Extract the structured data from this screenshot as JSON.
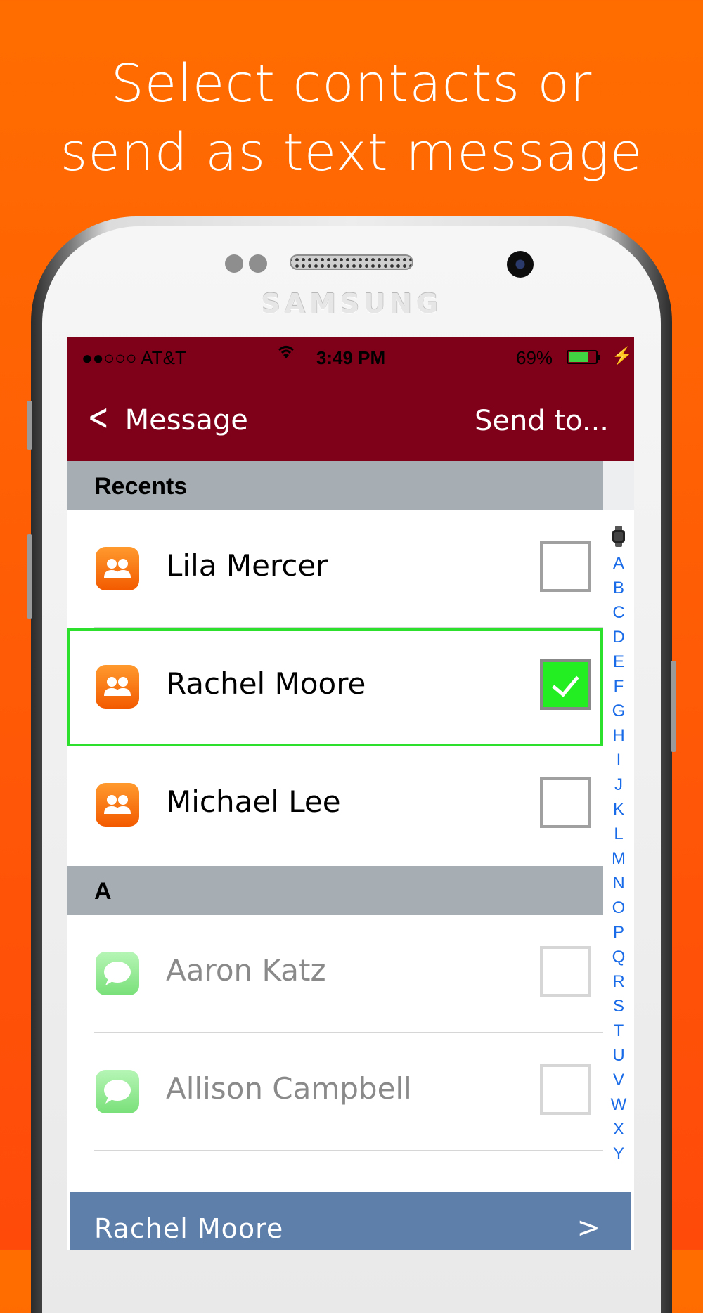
{
  "headline": {
    "line1": "Select contacts or",
    "line2": "send as text message"
  },
  "device": {
    "brand": "SAMSUNG"
  },
  "status_bar": {
    "carrier": "●●○○○ AT&T",
    "time": "3:49 PM",
    "battery_percent": "69%",
    "battery_level": 0.69
  },
  "nav": {
    "back_label": "Message",
    "title": "Send to..."
  },
  "sections": {
    "recents": "Recents",
    "a": "A"
  },
  "contacts": {
    "recents": [
      {
        "name": "Lila Mercer",
        "icon": "contact-app-icon",
        "checked": false
      },
      {
        "name": "Rachel Moore",
        "icon": "contact-app-icon",
        "checked": true
      },
      {
        "name": "Michael Lee",
        "icon": "contact-app-icon",
        "checked": false
      }
    ],
    "a": [
      {
        "name": "Aaron Katz",
        "icon": "messages-icon",
        "checked": false
      },
      {
        "name": "Allison Campbell",
        "icon": "messages-icon",
        "checked": false
      }
    ]
  },
  "index_letters": [
    "A",
    "B",
    "C",
    "D",
    "E",
    "F",
    "G",
    "H",
    "I",
    "J",
    "K",
    "L",
    "M",
    "N",
    "O",
    "P",
    "Q",
    "R",
    "S",
    "T",
    "U",
    "V",
    "W",
    "X",
    "Y"
  ],
  "selection_bar": {
    "name": "Rachel Moore",
    "arrow": ">"
  },
  "colors": {
    "background": "#ff6d00",
    "nav_bar": "#7f0019",
    "section_header": "#a6aeb4",
    "selected_outline": "#2de02d",
    "checkbox_on": "#22ee22",
    "index_text": "#1a6be8",
    "selection_bar": "#5f7fab"
  }
}
